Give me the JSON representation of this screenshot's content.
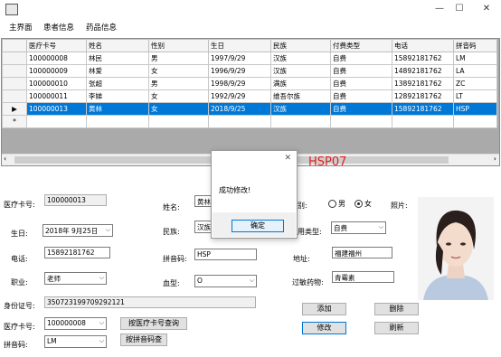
{
  "window": {
    "title": "",
    "minimize": "—",
    "maximize": "☐",
    "close": "✕"
  },
  "menu": [
    "主界面",
    "患者信息",
    "药品信息"
  ],
  "grid": {
    "columns": [
      "医疗卡号",
      "姓名",
      "性别",
      "生日",
      "民族",
      "付费类型",
      "电话",
      "拼音码"
    ],
    "rows": [
      [
        "100000008",
        "林民",
        "男",
        "1997/9/29",
        "汉族",
        "自费",
        "15892181762",
        "LM"
      ],
      [
        "100000009",
        "林爱",
        "女",
        "1996/9/29",
        "汉族",
        "自费",
        "14892181762",
        "LA"
      ],
      [
        "100000010",
        "张超",
        "男",
        "1998/9/29",
        "满族",
        "自费",
        "13892181762",
        "ZC"
      ],
      [
        "100000011",
        "李娣",
        "女",
        "1992/9/29",
        "维吾尔族",
        "自费",
        "12892181762",
        "LT"
      ],
      [
        "100000013",
        "黄林",
        "女",
        "2018/9/25",
        "汉族",
        "自费",
        "15892181762",
        "HSP"
      ]
    ],
    "selected_row": 4,
    "new_row_marker": "*",
    "current_row_marker": "▶"
  },
  "overlay_label": "HSP07",
  "dialog": {
    "message": "成功修改!",
    "ok_label": "确定",
    "close_icon": "✕"
  },
  "form": {
    "card_no_label": "医疗卡号:",
    "card_no_value": "100000013",
    "name_label": "姓名:",
    "name_value": "黄林",
    "gender_label": "性别:",
    "gender_male": "男",
    "gender_female": "女",
    "gender_selected": "女",
    "photo_label": "照片:",
    "birthday_label": "生日:",
    "birthday_value": "2018年 9月25日",
    "nation_label": "民族:",
    "nation_value": "汉族",
    "pay_label": "费用类型:",
    "pay_value": "自费",
    "phone_label": "电话:",
    "phone_value": "15892181762",
    "pinyin_label": "拼音码:",
    "pinyin_value": "HSP",
    "address_label": "地址:",
    "address_value": "福建福州",
    "job_label": "职业:",
    "job_value": "老师",
    "blood_label": "血型:",
    "blood_value": "O",
    "allergy_label": "过敏药物:",
    "allergy_value": "青霉素",
    "idcard_label": "身份证号:",
    "idcard_value": "350723199709292121",
    "search_card_label": "医疗卡号:",
    "search_card_value": "100000008",
    "search_card_button": "按医疗卡号查询",
    "search_pinyin_label": "拼音码:",
    "search_pinyin_value": "LM",
    "search_pinyin_button": "按拼音码查",
    "add_button": "添加",
    "delete_button": "删除",
    "modify_button": "修改",
    "refresh_button": "刷新"
  }
}
